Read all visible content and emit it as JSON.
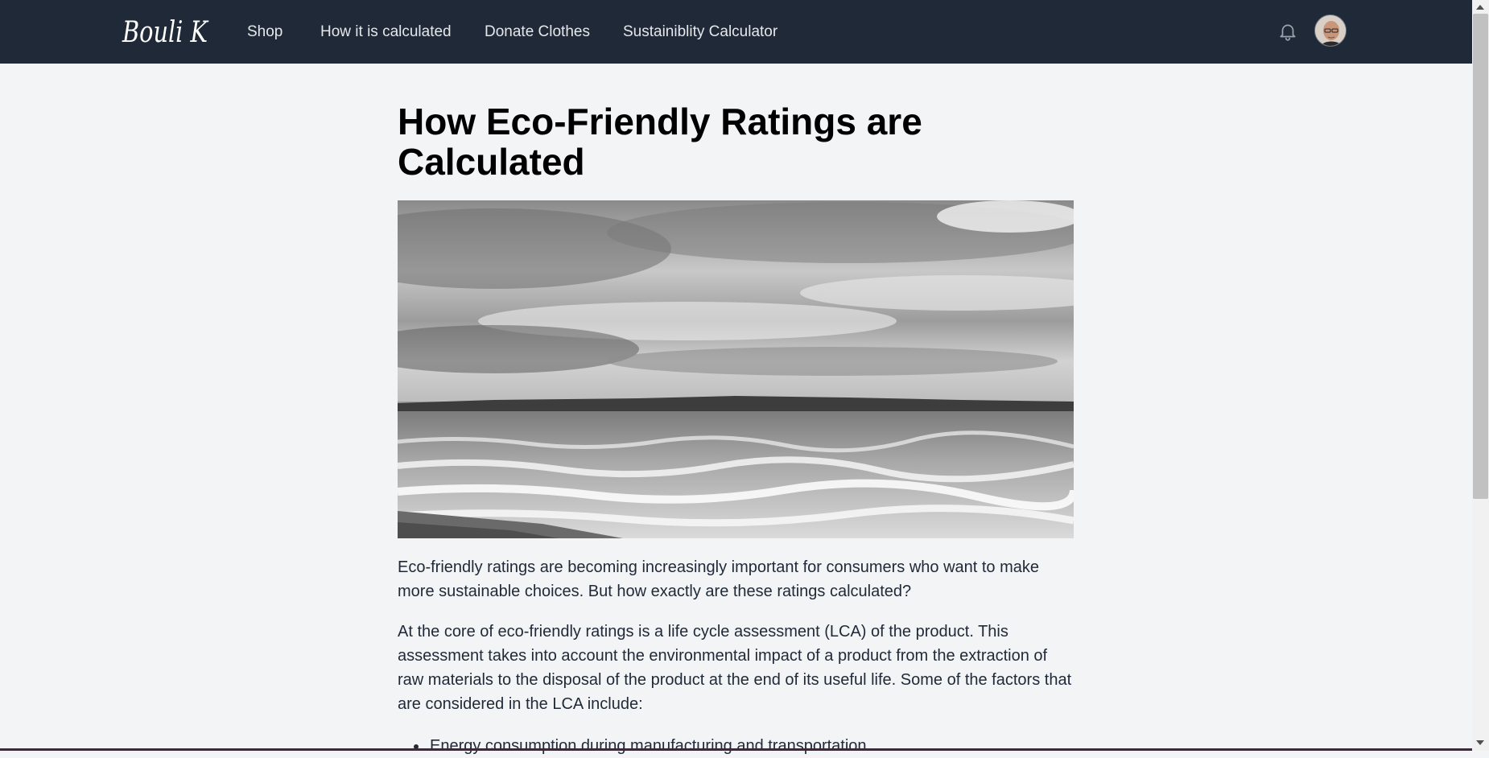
{
  "brand": {
    "logo_text": "Bouli K"
  },
  "nav": {
    "items": [
      {
        "label": "Shop"
      },
      {
        "label": "How it is calculated"
      },
      {
        "label": "Donate Clothes"
      },
      {
        "label": "Sustainiblity Calculator"
      }
    ]
  },
  "header_icons": {
    "notifications": "bell-icon",
    "profile": "avatar"
  },
  "article": {
    "title": "How Eco-Friendly Ratings are Calculated",
    "paragraphs": [
      "Eco-friendly ratings are becoming increasingly important for consumers who want to make more sustainable choices. But how exactly are these ratings calculated?",
      "At the core of eco-friendly ratings is a life cycle assessment (LCA) of the product. This assessment takes into account the environmental impact of a product from the extraction of raw materials to the disposal of the product at the end of its useful life. Some of the factors that are considered in the LCA include:"
    ],
    "list": [
      "Energy consumption during manufacturing and transportation"
    ]
  },
  "colors": {
    "topbar": "#1f2937",
    "page_background": "#f3f4f6",
    "nav_text": "#e5e7eb",
    "heading": "#000000"
  }
}
